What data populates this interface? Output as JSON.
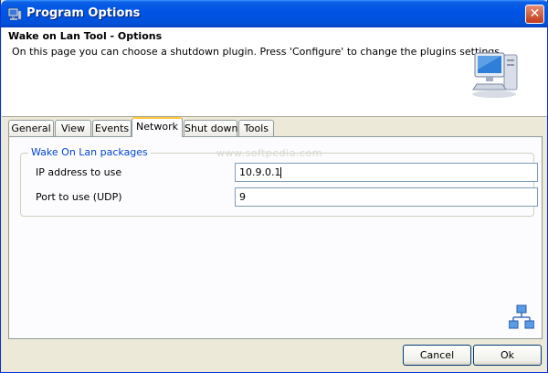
{
  "window": {
    "title": "Program Options",
    "close_icon": "close-icon"
  },
  "header": {
    "title": "Wake on Lan Tool - Options",
    "description": "On this page you can choose a shutdown plugin. Press 'Configure' to change the plugins settings.",
    "icon": "computer-icon"
  },
  "tabs": [
    {
      "label": "General"
    },
    {
      "label": "View"
    },
    {
      "label": "Events"
    },
    {
      "label": "Network",
      "active": true
    },
    {
      "label": "Shut down"
    },
    {
      "label": "Tools"
    }
  ],
  "network": {
    "group_title": "Wake On Lan packages",
    "ip_label": "IP address to use",
    "ip_value": "10.9.0.1",
    "port_label": "Port to use (UDP)",
    "port_value": "9",
    "watermark": "www.softpedia.com"
  },
  "buttons": {
    "cancel": "Cancel",
    "ok": "Ok"
  },
  "colors": {
    "title_bar": "#0055e5",
    "accent_tab": "#ffc83c",
    "group_title": "#0046d5",
    "face": "#ece9d8"
  }
}
